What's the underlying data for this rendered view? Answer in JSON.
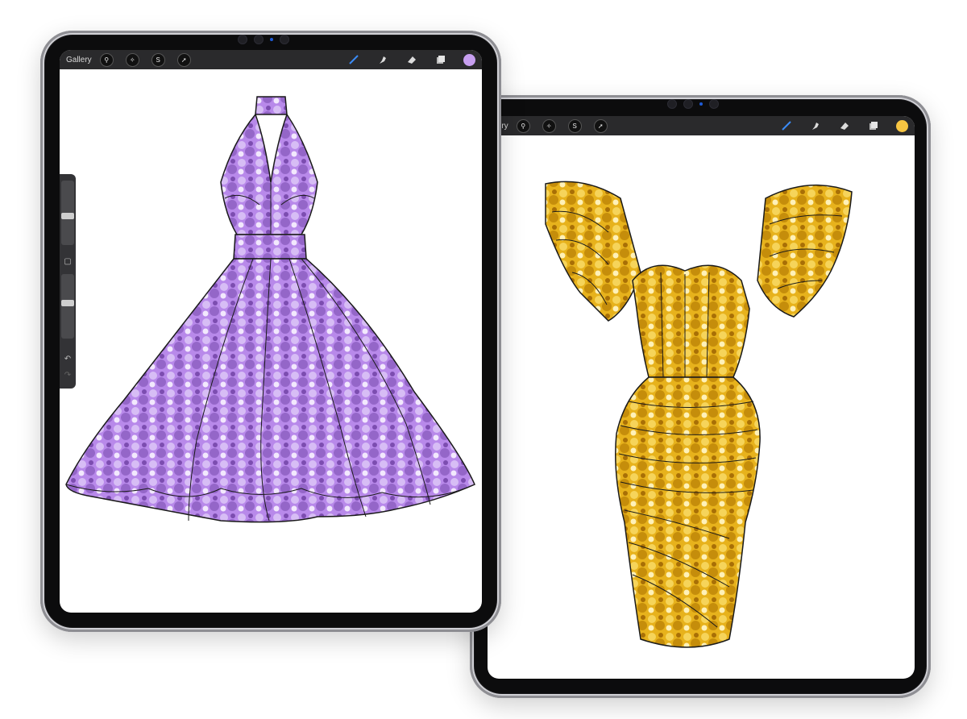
{
  "left_device": {
    "toolbar": {
      "gallery_label": "Gallery",
      "tool_icons": [
        "wrench-icon",
        "magic-wand-icon",
        "selection-icon",
        "transform-arrow-icon"
      ],
      "right_icons": [
        "brush-icon",
        "smudge-icon",
        "eraser-icon",
        "layers-icon"
      ],
      "active_tool": "brush",
      "color": "#c79ff0"
    },
    "sidebar": {
      "brush_size": 0.45,
      "opacity": 0.55
    },
    "canvas": {
      "subject": "purple sequin halter dress sketch",
      "fabric_color": "#b889ea"
    }
  },
  "right_device": {
    "toolbar": {
      "gallery_label": "Gallery",
      "tool_icons": [
        "wrench-icon",
        "magic-wand-icon",
        "selection-icon",
        "transform-arrow-icon"
      ],
      "right_icons": [
        "brush-icon",
        "smudge-icon",
        "eraser-icon",
        "layers-icon"
      ],
      "active_tool": "brush",
      "color": "#f7c542"
    },
    "canvas": {
      "subject": "gold sequin ruffle-sleeve dress sketch",
      "fabric_color": "#e8b520"
    }
  }
}
